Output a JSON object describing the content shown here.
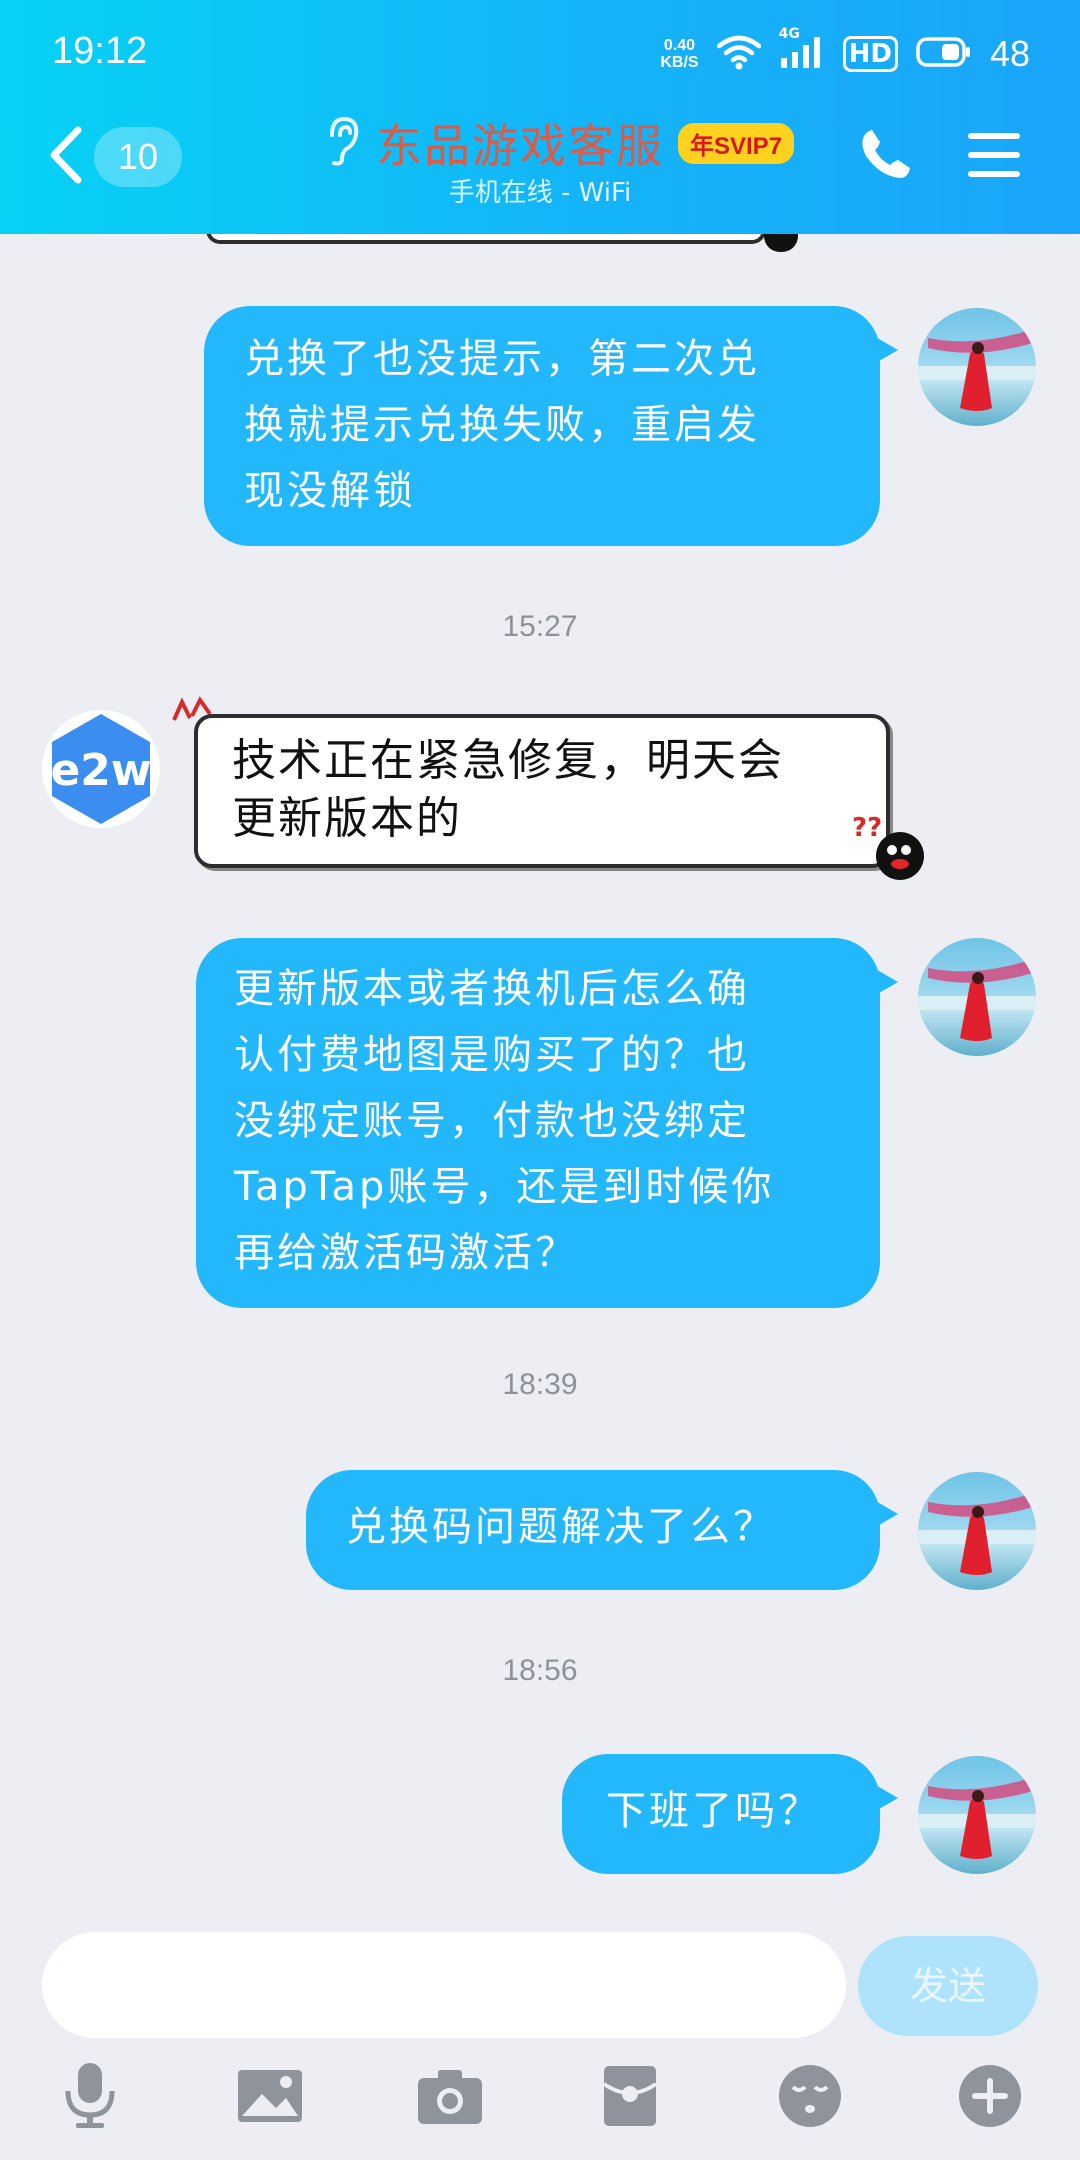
{
  "status_bar": {
    "time": "19:12",
    "net_speed_top": "0.40",
    "net_speed_bottom": "KB/S",
    "signal_label": "4G",
    "hd_label": "HD",
    "battery": "48"
  },
  "header": {
    "unread_count": "10",
    "title": "东品游戏客服",
    "vip_badge": "年SVIP7",
    "subtitle": "手机在线 - WiFi"
  },
  "messages": [
    {
      "from": "me",
      "text": "兑换了也没提示，第二次兑换就提示兑换失败，重启发现没解锁"
    },
    {
      "timestamp": "15:27"
    },
    {
      "from": "service",
      "text": "技术正在紧急修复，明天会更新版本的"
    },
    {
      "from": "me",
      "text": "更新版本或者换机后怎么确认付费地图是购买了的？也没绑定账号，付款也没绑定TapTap账号，还是到时候你再给激活码激活？"
    },
    {
      "timestamp": "18:39"
    },
    {
      "from": "me",
      "text": "兑换码问题解决了么？"
    },
    {
      "timestamp": "18:56"
    },
    {
      "from": "me",
      "text": "下班了吗？"
    }
  ],
  "chat": {
    "m1_line1": "兑换了也没提示，第二次兑",
    "m1_line2": "换就提示兑换失败，重启发",
    "m1_line3": "现没解锁",
    "ts1": "15:27",
    "m2_line1": "技术正在紧急修复，明天会",
    "m2_line2": "更新版本的",
    "m3_line1": "更新版本或者换机后怎么确",
    "m3_line2": "认付费地图是购买了的？也",
    "m3_line3": "没绑定账号，付款也没绑定",
    "m3_line4": "TapTap账号，还是到时候你",
    "m3_line5": "再给激活码激活？",
    "ts2": "18:39",
    "m4": "兑换码问题解决了么？",
    "ts3": "18:56",
    "m5": "下班了吗？",
    "service_logo": "e2w"
  },
  "input": {
    "placeholder": "",
    "send_label": "发送"
  },
  "toolbar": [
    "mic-icon",
    "image-icon",
    "camera-icon",
    "red-packet-icon",
    "emoji-icon",
    "plus-icon"
  ],
  "colors": {
    "header_start": "#06d2f6",
    "header_end": "#1ba5f9",
    "bubble_out": "#23b7fb",
    "background": "#eceef3",
    "title": "#e05a43"
  }
}
